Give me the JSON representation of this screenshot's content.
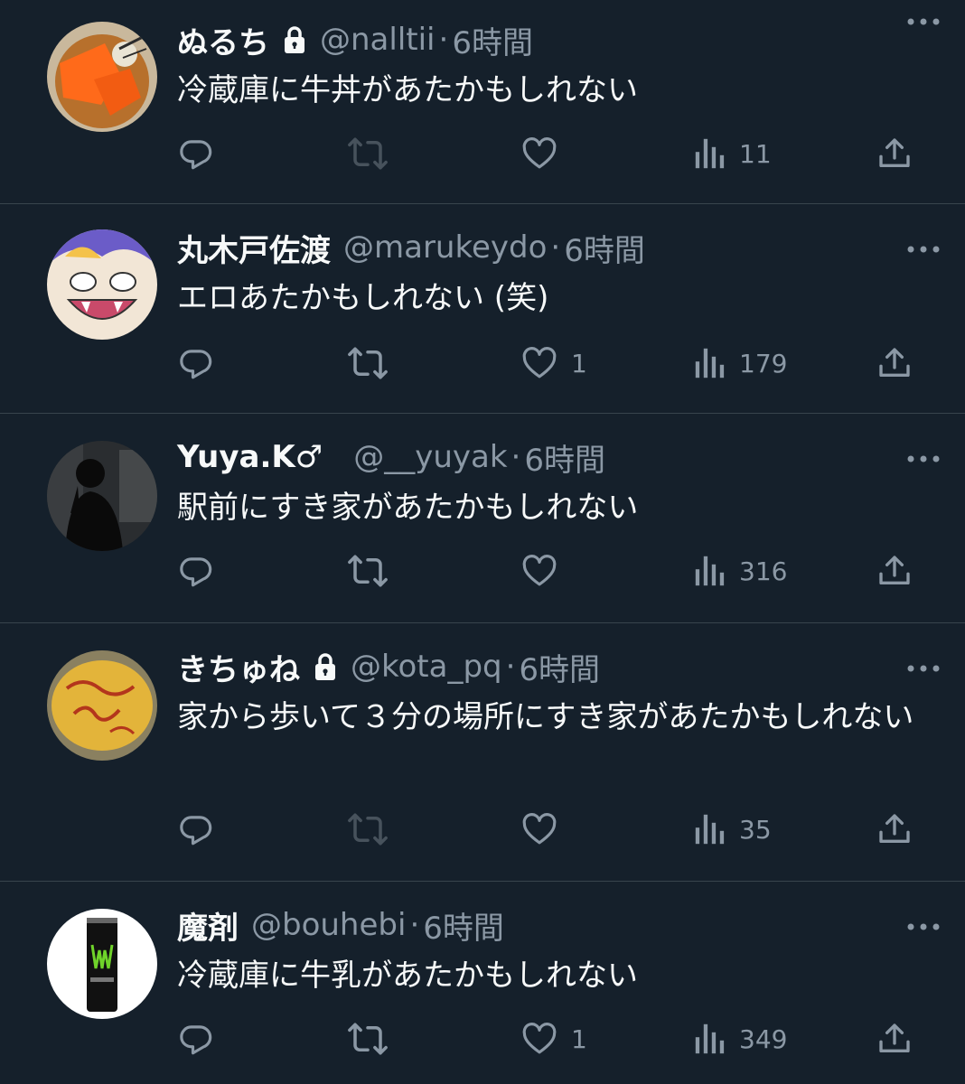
{
  "tweets": [
    {
      "name": "ぬるち",
      "locked": true,
      "handle": "@nalltii",
      "time": "6時間",
      "text": "冷蔵庫に牛丼があたかもしれない",
      "retweets_disabled": true,
      "likes": "",
      "views": "11"
    },
    {
      "name": "丸木戸佐渡",
      "locked": false,
      "handle": "@marukeydo",
      "time": "6時間",
      "text": "エロあたかもしれない (笑)",
      "retweets_disabled": false,
      "likes": "1",
      "views": "179"
    },
    {
      "name": "Yuya.K♂",
      "locked": false,
      "handle": "@__yuyak",
      "time": "6時間",
      "text": "駅前にすき家があたかもしれない",
      "retweets_disabled": false,
      "likes": "",
      "views": "316"
    },
    {
      "name": "きちゅね",
      "locked": true,
      "handle": "@kota_pq",
      "time": "6時間",
      "text": "家から歩いて３分の場所にすき家があたかもしれない",
      "retweets_disabled": true,
      "likes": "",
      "views": "35"
    },
    {
      "name": "魔剤",
      "locked": false,
      "handle": "@bouhebi",
      "time": "6時間",
      "text": "冷蔵庫に牛乳があたかもしれない",
      "retweets_disabled": false,
      "likes": "1",
      "views": "349"
    }
  ],
  "avatars": [
    "food-photo-avatar",
    "anime-face-avatar",
    "silhouette-photo-avatar",
    "omelette-photo-avatar",
    "energy-drink-can-avatar"
  ],
  "colors": {
    "background": "#15202b",
    "divider": "#38444d",
    "text_primary": "#f7f9f9",
    "text_secondary": "#8b98a5",
    "icon_disabled": "#47525c"
  }
}
